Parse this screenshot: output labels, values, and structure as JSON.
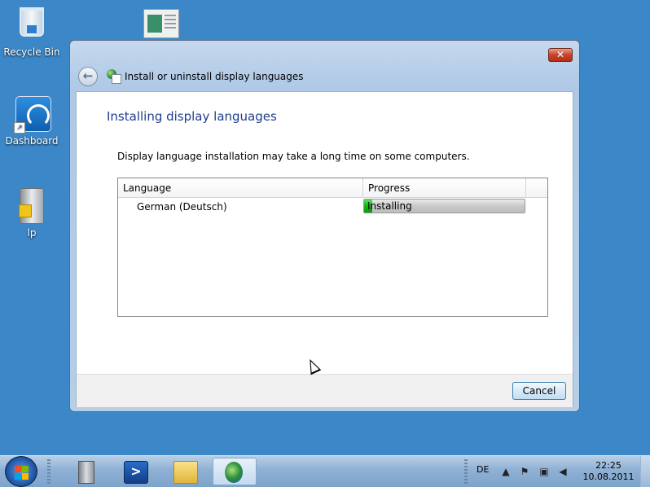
{
  "desktop": {
    "icons": [
      {
        "label": "Recycle Bin",
        "icon": "recycle-bin-icon"
      },
      {
        "label": "Dashboard",
        "icon": "dashboard-icon"
      },
      {
        "label": "lp",
        "icon": "server-icon"
      },
      {
        "label": "",
        "icon": "document-icon"
      }
    ]
  },
  "window": {
    "title": "Install or uninstall display languages",
    "close_label": "✕",
    "heading": "Installing display languages",
    "description": "Display language installation may take a long time on some computers.",
    "table": {
      "columns": [
        "Language",
        "Progress"
      ],
      "rows": [
        {
          "language": "German (Deutsch)",
          "progress_text": "Installing",
          "progress_fraction": 0.05
        }
      ]
    },
    "cancel_label": "Cancel"
  },
  "taskbar": {
    "pinned": [
      "server-manager-icon",
      "powershell-icon",
      "explorer-folder-icon",
      "language-installer-icon"
    ],
    "language": "DE",
    "time": "22:25",
    "date": "10.08.2011",
    "colors": {
      "progress_green": "#17b317",
      "heading_blue": "#1e3d8c",
      "desktop": "#3b87c8"
    }
  }
}
